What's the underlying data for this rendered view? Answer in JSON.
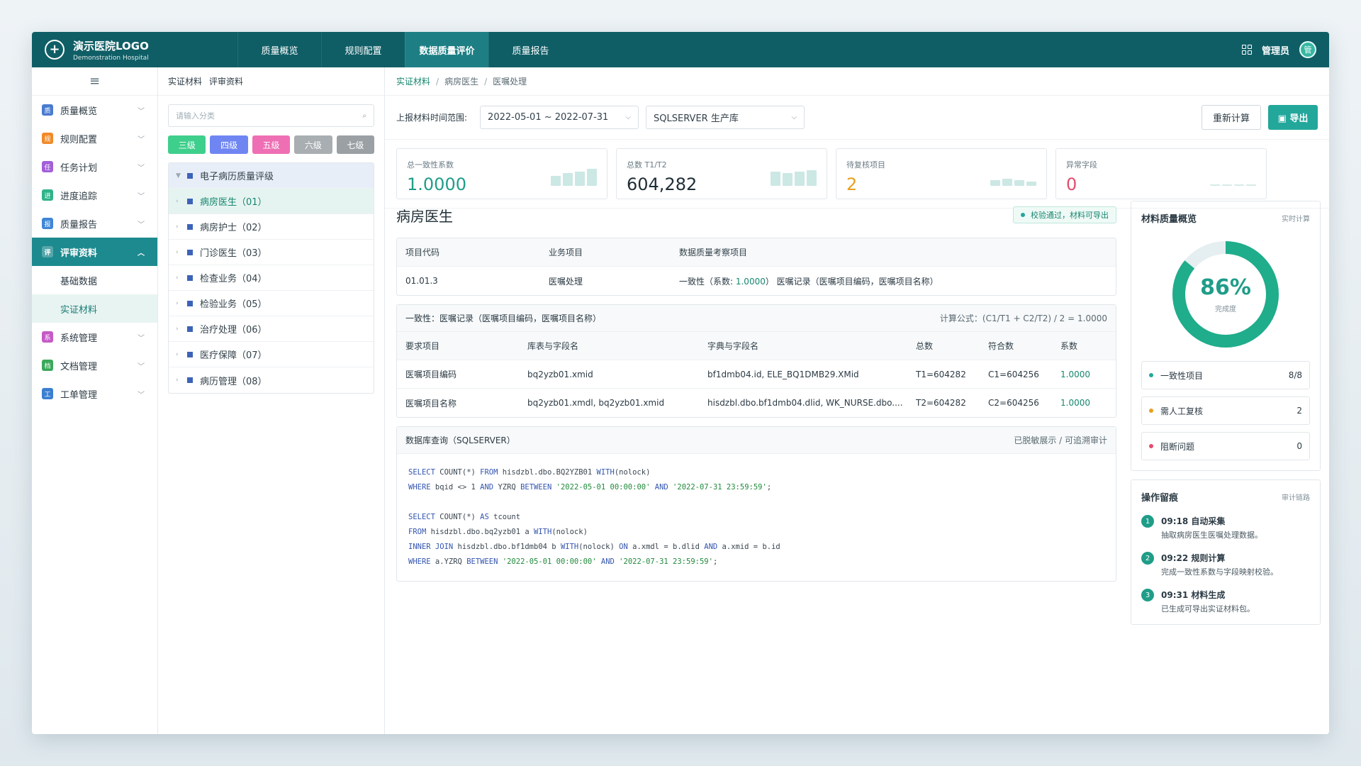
{
  "logo": {
    "title": "演示医院LOGO",
    "subtitle": "Demonstration Hospital",
    "mark": "+"
  },
  "nav": [
    "质量概览",
    "规则配置",
    "数据质量评价",
    "质量报告"
  ],
  "user": {
    "name": "管理员",
    "avatar": "管"
  },
  "sidebar": {
    "menu_icon": "≡",
    "items": [
      {
        "badge": "质",
        "label": "质量概览",
        "color": "#4a7bd0"
      },
      {
        "badge": "规",
        "label": "规则配置",
        "color": "#f08a2a"
      },
      {
        "badge": "任",
        "label": "任务计划",
        "color": "#a35fd8"
      },
      {
        "badge": "进",
        "label": "进度追踪",
        "color": "#2fb38a"
      },
      {
        "badge": "报",
        "label": "质量报告",
        "color": "#3f86d6"
      },
      {
        "badge": "评",
        "label": "评审资料",
        "color": "#1d8a8f"
      },
      {
        "badge": "系",
        "label": "系统管理",
        "color": "#c55ac7"
      },
      {
        "badge": "档",
        "label": "文档管理",
        "color": "#3aa85a"
      },
      {
        "badge": "工",
        "label": "工单管理",
        "color": "#3b7fd0"
      }
    ],
    "sub": [
      "基础数据",
      "实证材料"
    ]
  },
  "tree": {
    "tabs": [
      "实证材料",
      "评审资料"
    ],
    "search_placeholder": "请输入分类",
    "levels": [
      {
        "label": "三级",
        "color": "#3fcf8c"
      },
      {
        "label": "四级",
        "color": "#6f86f2"
      },
      {
        "label": "五级",
        "color": "#ef6fb4"
      },
      {
        "label": "六级",
        "color": "#a8aeb2"
      },
      {
        "label": "七级",
        "color": "#9aa0a4"
      }
    ],
    "root": "电子病历质量评级",
    "nodes": [
      "病房医生（01）",
      "病房护士（02）",
      "门诊医生（03）",
      "检查业务（04）",
      "检验业务（05）",
      "治疗处理（06）",
      "医疗保障（07）",
      "病历管理（08）"
    ]
  },
  "breadcrumb": [
    "实证材料",
    "病房医生",
    "医嘱处理"
  ],
  "filters": {
    "label": "上报材料时间范围:",
    "date_range": "2022-05-01 ~ 2022-07-31",
    "db": "SQLSERVER 生产库",
    "recalc": "重新计算",
    "export": "▣ 导出"
  },
  "stats": [
    {
      "label": "总一致性系数",
      "value": "1.0000",
      "color": "#1f9d88"
    },
    {
      "label": "总数 T1/T2",
      "value": "604,282",
      "color": "#1f2e36"
    },
    {
      "label": "待复核项目",
      "value": "2",
      "color": "#e6a01f"
    },
    {
      "label": "异常字段",
      "value": "0",
      "color": "#e64b6b"
    }
  ],
  "section": {
    "title": "病房医生",
    "status": "校验通过，材料可导出"
  },
  "project_table": {
    "headers": [
      "项目代码",
      "业务项目",
      "数据质量考察项目"
    ],
    "row": {
      "code": "01.01.3",
      "business": "医嘱处理",
      "quality_a": "一致性（系数: ",
      "coef": "1.0000",
      "quality_b": "）   医嘱记录（医嘱项目编码，医嘱项目名称）"
    }
  },
  "consistency": {
    "title": "一致性：医嘱记录（医嘱项目编码，医嘱项目名称）",
    "formula": "计算公式：(C1/T1 + C2/T2) / 2 = 1.0000",
    "headers": [
      "要求项目",
      "库表与字段名",
      "字典与字段名",
      "总数",
      "符合数",
      "系数"
    ],
    "rows": [
      [
        "医嘱项目编码",
        "bq2yzb01.xmid",
        "bf1dmb04.id, ELE_BQ1DMB29.XMid",
        "T1=604282",
        "C1=604256",
        "1.0000"
      ],
      [
        "医嘱项目名称",
        "bq2yzb01.xmdl, bq2yzb01.xmid",
        "hisdzbl.dbo.bf1dmb04.dlid, WK_NURSE.dbo....",
        "T2=604282",
        "C2=604256",
        "1.0000"
      ]
    ]
  },
  "sql": {
    "title": "数据库查询（SQLSERVER）",
    "note": "已脱敏展示 / 可追溯审计"
  },
  "overview": {
    "title": "材料质量概览",
    "sub": "实时计算",
    "percent": 86,
    "percent_label": "86%",
    "caption": "完成度",
    "items": [
      {
        "label": "一致性项目",
        "value": "8/8",
        "color": "#23a79b"
      },
      {
        "label": "需人工复核",
        "value": "2",
        "color": "#e6a01f"
      },
      {
        "label": "阻断问题",
        "value": "0",
        "color": "#e64b6b"
      }
    ]
  },
  "log": {
    "title": "操作留痕",
    "sub": "审计链路",
    "steps": [
      {
        "n": "1",
        "t": "09:18 自动采集",
        "d": "抽取病房医生医嘱处理数据。"
      },
      {
        "n": "2",
        "t": "09:22 规则计算",
        "d": "完成一致性系数与字段映射校验。"
      },
      {
        "n": "3",
        "t": "09:31 材料生成",
        "d": "已生成可导出实证材料包。"
      }
    ]
  }
}
